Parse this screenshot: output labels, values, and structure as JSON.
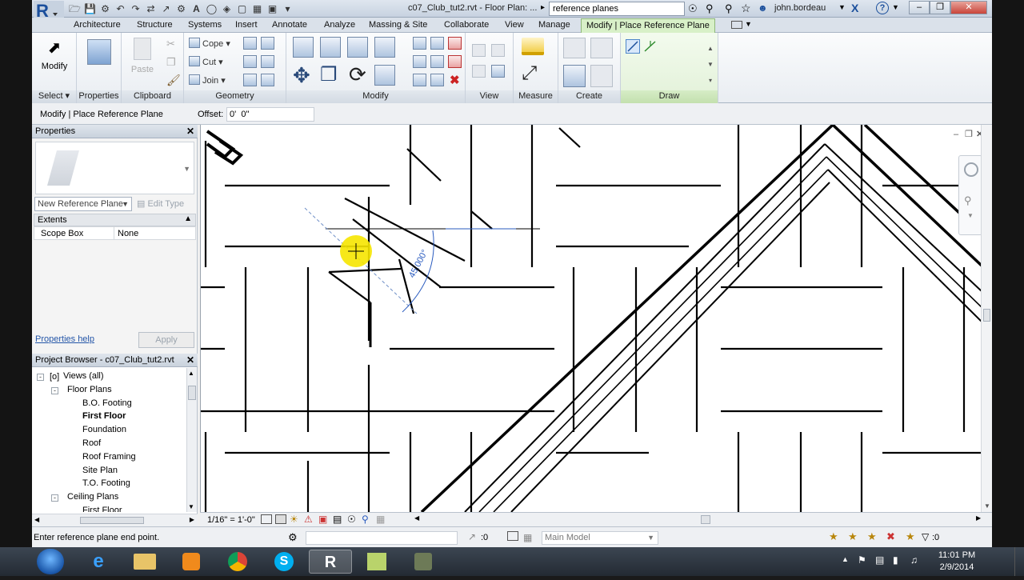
{
  "window": {
    "title": "c07_Club_tut2.rvt - Floor Plan: ...",
    "search_value": "reference planes",
    "user": "john.bordeau"
  },
  "ribbon_tabs": [
    "Architecture",
    "Structure",
    "Systems",
    "Insert",
    "Annotate",
    "Analyze",
    "Massing & Site",
    "Collaborate",
    "View",
    "Manage",
    "Modify | Place Reference Plane"
  ],
  "ribbon": {
    "modify_label": "Modify",
    "paste_label": "Paste",
    "cope_label": "Cope",
    "cut_label": "Cut",
    "join_label": "Join",
    "panels": [
      "Select",
      "Properties",
      "Clipboard",
      "Geometry",
      "Modify",
      "View",
      "Measure",
      "Create",
      "Draw"
    ]
  },
  "options_bar": {
    "context_label": "Modify | Place Reference Plane",
    "offset_label": "Offset:",
    "offset_value": "0'  0\""
  },
  "properties": {
    "title": "Properties",
    "type_selector": "New Reference Plane",
    "edit_type_label": "Edit Type",
    "group": "Extents",
    "row_name": "Scope Box",
    "row_value": "None",
    "help_link": "Properties help",
    "apply_label": "Apply"
  },
  "project_browser": {
    "title": "Project Browser - c07_Club_tut2.rvt",
    "items": [
      {
        "label": "Views (all)",
        "level": 0,
        "toggle": "-"
      },
      {
        "label": "Floor Plans",
        "level": 1,
        "toggle": "-"
      },
      {
        "label": "B.O. Footing",
        "level": 2
      },
      {
        "label": "First Floor",
        "level": 2,
        "bold": true
      },
      {
        "label": "Foundation",
        "level": 2
      },
      {
        "label": "Roof",
        "level": 2
      },
      {
        "label": "Roof Framing",
        "level": 2
      },
      {
        "label": "Site Plan",
        "level": 2
      },
      {
        "label": "T.O. Footing",
        "level": 2
      },
      {
        "label": "Ceiling Plans",
        "level": 1,
        "toggle": "-"
      },
      {
        "label": "First Floor",
        "level": 2
      }
    ]
  },
  "view": {
    "angle_dimension": "45.000°",
    "scale": "1/16\" = 1'-0\""
  },
  "status": {
    "text": "Enter reference plane end point.",
    "count_a": ":0",
    "model": "Main Model",
    "count_b": ":0"
  },
  "taskbar": {
    "time": "11:01 PM",
    "date": "2/9/2014"
  },
  "colors": {
    "accent_tab": "#d8f0c8",
    "revit_blue": "#1b4f9c",
    "cursor_highlight": "#f6e600",
    "dimension_blue": "#2a5bbf"
  }
}
